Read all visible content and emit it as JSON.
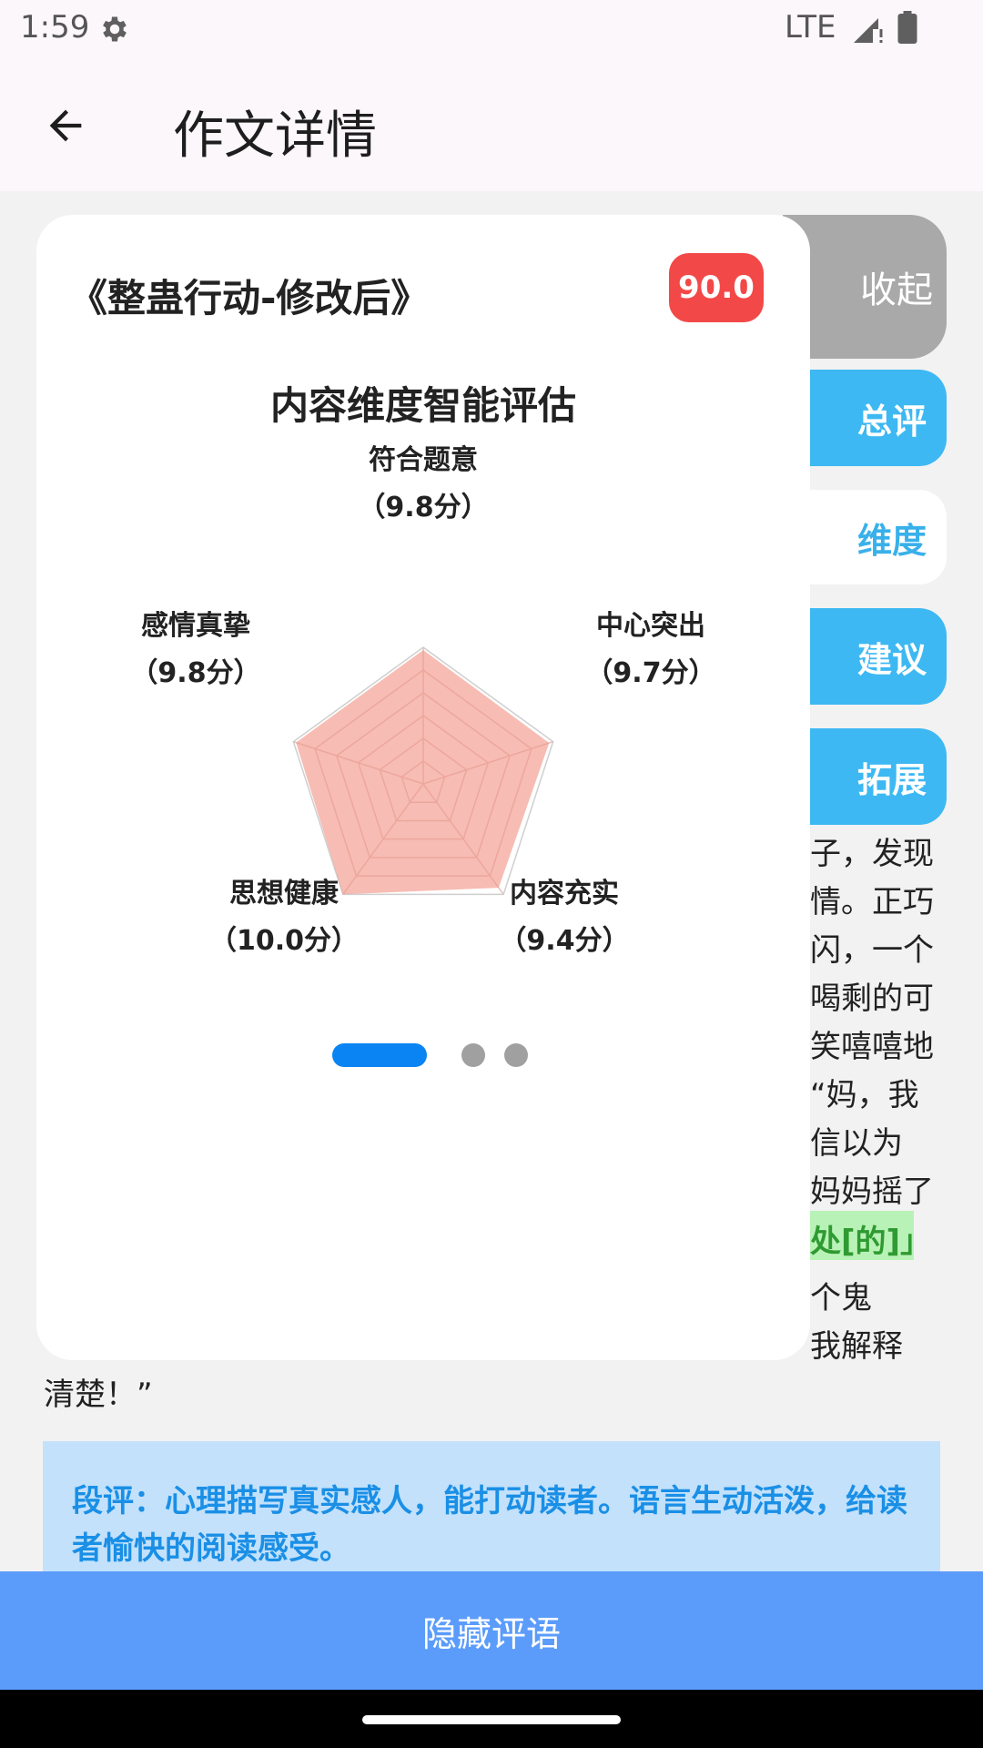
{
  "status": {
    "time": "1:59",
    "network": "LTE"
  },
  "appbar": {
    "title": "作文详情"
  },
  "essay_bg": {
    "lines": [
      "子，发现",
      "情。正巧",
      "闪，一个",
      "喝剩的可",
      "笑嘻嘻地",
      "“妈，我",
      "信以为",
      "妈妈摇了",
      "个鬼",
      "我解释",
      "清楚！”"
    ],
    "highlight": "处[的]」"
  },
  "comment": {
    "text": "段评：心理描写真实感人，能打动读者。语言生动活泼，给读者愉快的阅读感受。"
  },
  "side_tabs": {
    "collapse": "收起",
    "summary": "总评",
    "dimension": "维度",
    "suggest": "建议",
    "extend": "拓展"
  },
  "card": {
    "essay_title": "《整蛊行动-修改后》",
    "score": "90.0",
    "heading": "内容维度智能评估",
    "dimensions": [
      {
        "name": "符合题意",
        "score_label": "（9.8分）",
        "score": 9.8
      },
      {
        "name": "中心突出",
        "score_label": "（9.7分）",
        "score": 9.7
      },
      {
        "name": "内容充实",
        "score_label": "（9.4分）",
        "score": 9.4
      },
      {
        "name": "思想健康",
        "score_label": "（10.0分）",
        "score": 10.0
      },
      {
        "name": "感情真挚",
        "score_label": "（9.8分）",
        "score": 9.8
      }
    ],
    "max_score": 10,
    "fill_color": "#f2988a",
    "page_total": 3,
    "page_index": 0
  },
  "bottom": {
    "hide_label": "隐藏评语"
  }
}
